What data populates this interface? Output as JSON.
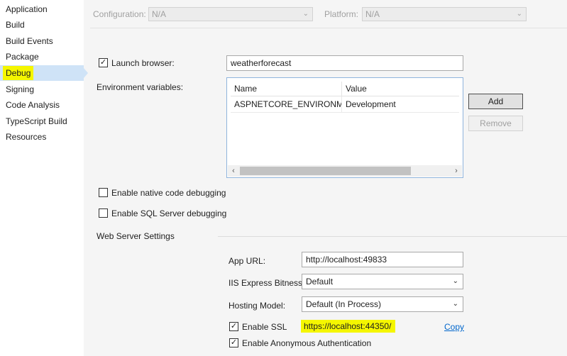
{
  "sidebar": {
    "items": [
      {
        "label": "Application"
      },
      {
        "label": "Build"
      },
      {
        "label": "Build Events"
      },
      {
        "label": "Package"
      },
      {
        "label": "Debug"
      },
      {
        "label": "Signing"
      },
      {
        "label": "Code Analysis"
      },
      {
        "label": "TypeScript Build"
      },
      {
        "label": "Resources"
      }
    ],
    "active_index": 4
  },
  "config_bar": {
    "configuration_label": "Configuration:",
    "configuration_value": "N/A",
    "platform_label": "Platform:",
    "platform_value": "N/A"
  },
  "debug": {
    "launch_browser": {
      "label": "Launch browser:",
      "checked": true,
      "value": "weatherforecast"
    },
    "env_vars": {
      "label": "Environment variables:",
      "columns": [
        "Name",
        "Value"
      ],
      "rows": [
        {
          "name": "ASPNETCORE_ENVIRONMENT",
          "value": "Development"
        }
      ],
      "add_label": "Add",
      "remove_label": "Remove"
    },
    "native_debugging": {
      "label": "Enable native code debugging",
      "checked": false
    },
    "sql_debugging": {
      "label": "Enable SQL Server debugging",
      "checked": false
    }
  },
  "web_server": {
    "section_label": "Web Server Settings",
    "app_url": {
      "label": "App URL:",
      "value": "http://localhost:49833"
    },
    "iis_bitness": {
      "label": "IIS Express Bitness:",
      "value": "Default"
    },
    "hosting_model": {
      "label": "Hosting Model:",
      "value": "Default (In Process)"
    },
    "ssl": {
      "label": "Enable SSL",
      "checked": true,
      "url": "https://localhost:44350/",
      "copy_label": "Copy"
    },
    "anon_auth": {
      "label": "Enable Anonymous Authentication",
      "checked": true
    }
  },
  "icons": {
    "checkmark": "✓",
    "chevron_down": "⌄",
    "scroll_left": "‹",
    "scroll_right": "›"
  },
  "colors": {
    "highlight_yellow": "#f5f600",
    "sidebar_selected": "#cfe3f7",
    "link": "#0066cc"
  }
}
